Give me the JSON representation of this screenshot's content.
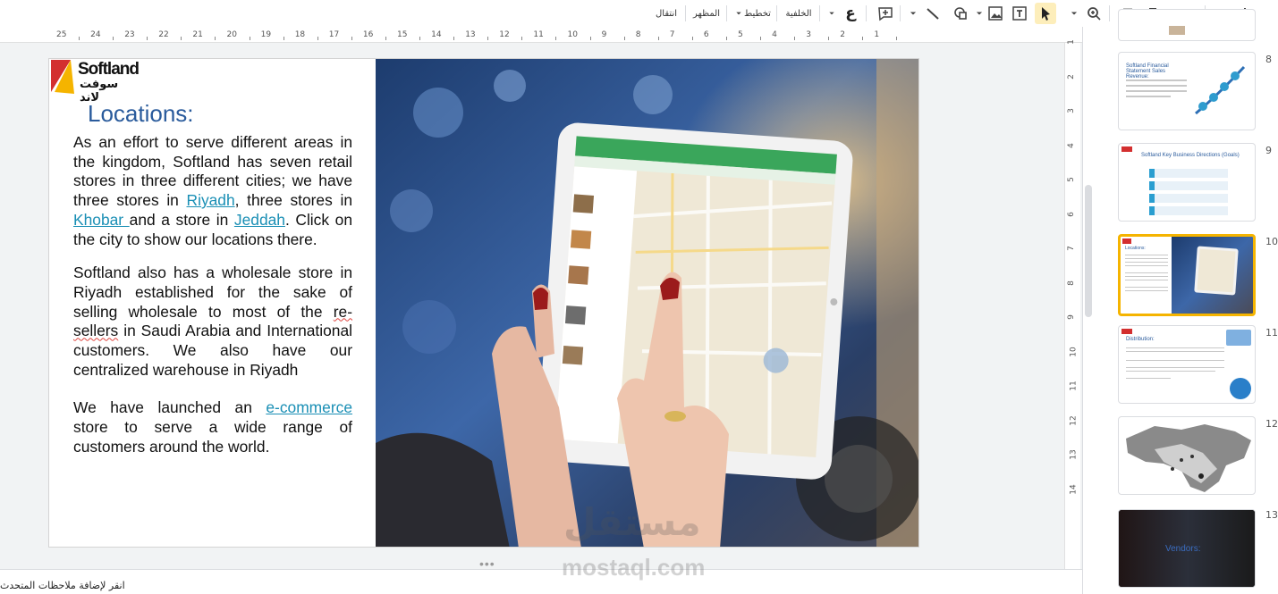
{
  "toolbar": {
    "transition_label": "انتقال",
    "theme_label": "المظهر",
    "layout_label": "تخطيط",
    "background_label": "الخلفية",
    "font_glyph": "ع",
    "icons": [
      "plus-icon",
      "more-arrow-icon",
      "paint-format-icon",
      "print-icon",
      "undo-icon",
      "redo-icon",
      "zoom-icon",
      "select-icon",
      "text-box-icon",
      "image-icon",
      "shape-icon",
      "line-icon",
      "comment-icon"
    ]
  },
  "ruler": {
    "labels": [
      "25",
      "24",
      "23",
      "22",
      "21",
      "20",
      "19",
      "18",
      "17",
      "16",
      "15",
      "14",
      "13",
      "12",
      "11",
      "10",
      "9",
      "8",
      "7",
      "6",
      "5",
      "4",
      "3",
      "2",
      "1"
    ]
  },
  "vruler": {
    "labels": [
      "1",
      "2",
      "3",
      "4",
      "5",
      "6",
      "7",
      "8",
      "9",
      "10",
      "11",
      "12",
      "13",
      "14"
    ]
  },
  "slide": {
    "logo_text": "Softland",
    "logo_arabic": "سوفت لاند",
    "title": "Locations:",
    "p1_a": "As an effort to serve different areas in the kingdom, Softland has seven retail stores in three different cities; we have three stores in ",
    "p1_link_riyadh": "Riyadh",
    "p1_b": ", three stores in ",
    "p1_link_khobar": "Khobar ",
    "p1_c": "and a store in ",
    "p1_link_jeddah": "Jeddah",
    "p1_d": ". Click on the city to show our locations there.",
    "p2_a": "Softland also has a wholesale store in Riyadh established  for the sake of selling wholesale to most of the ",
    "p2_squig": "re-sellers",
    "p2_b": " in Saudi Arabia and International customers. We also have our centralized warehouse in Riyadh",
    "p3_a": "We have launched an ",
    "p3_link": "e-commerce",
    "p3_b": " store to serve a wide range of customers around the world."
  },
  "notes": {
    "placeholder": "انقر لإضافة ملاحظات المتحدث"
  },
  "thumbnails": [
    {
      "num": "8",
      "title": "Softland Financial Statement Sales Revenue:"
    },
    {
      "num": "9",
      "title": "Softland Key Business Directions (Goals)"
    },
    {
      "num": "10",
      "title": "Locations:"
    },
    {
      "num": "11",
      "title": "Distribution:"
    },
    {
      "num": "12",
      "title": ""
    },
    {
      "num": "13",
      "title": "Vendors:"
    }
  ],
  "watermark": {
    "text": "mostaql.com",
    "arabic": "مستقل"
  }
}
